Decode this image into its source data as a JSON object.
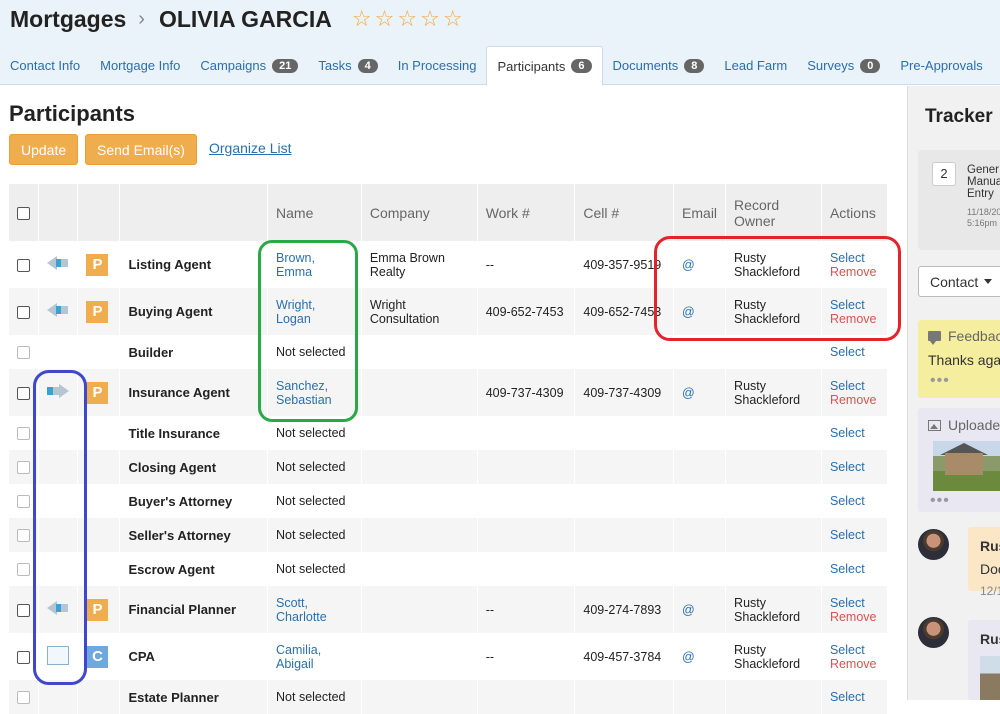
{
  "header": {
    "app": "Mortgages",
    "separator": "›",
    "contact_name": "OLIVIA GARCIA",
    "rating_stars": 0,
    "star_glyph": "☆"
  },
  "tabs": [
    {
      "label": "Contact Info",
      "badge": ""
    },
    {
      "label": "Mortgage Info",
      "badge": ""
    },
    {
      "label": "Campaigns",
      "badge": "21"
    },
    {
      "label": "Tasks",
      "badge": "4"
    },
    {
      "label": "In Processing",
      "badge": ""
    },
    {
      "label": "Participants",
      "badge": "6",
      "active": true
    },
    {
      "label": "Documents",
      "badge": "8"
    },
    {
      "label": "Lead Farm",
      "badge": ""
    },
    {
      "label": "Surveys",
      "badge": "0"
    },
    {
      "label": "Pre-Approvals",
      "badge": ""
    },
    {
      "label": "R",
      "badge": ""
    }
  ],
  "main": {
    "title": "Participants",
    "update_label": "Update",
    "send_label": "Send Email(s)",
    "organize_label": "Organize List"
  },
  "table": {
    "headers": {
      "name": "Name",
      "company": "Company",
      "work": "Work #",
      "cell": "Cell #",
      "email": "Email",
      "owner": "Record Owner",
      "actions": "Actions"
    },
    "rows": [
      {
        "role": "Listing Agent",
        "arrow": "left",
        "badge": "P",
        "name": "Brown, Emma",
        "company": "Emma Brown Realty",
        "work": "--",
        "cell": "409-357-9519",
        "email": "@",
        "owner": "Rusty Shackleford",
        "select": "Select",
        "remove": "Remove"
      },
      {
        "role": "Buying Agent",
        "arrow": "left",
        "badge": "P",
        "name": "Wright, Logan",
        "company": "Wright Consultation",
        "work": "409-652-7453",
        "cell": "409-652-7453",
        "email": "@",
        "owner": "Rusty Shackleford",
        "select": "Select",
        "remove": "Remove"
      },
      {
        "role": "Builder",
        "arrow": "",
        "badge": "",
        "name": "Not selected",
        "company": "",
        "work": "",
        "cell": "",
        "email": "",
        "owner": "",
        "select": "Select",
        "remove": ""
      },
      {
        "role": "Insurance Agent",
        "arrow": "right",
        "badge": "P",
        "name": "Sanchez, Sebastian",
        "company": "",
        "work": "409-737-4309",
        "cell": "409-737-4309",
        "email": "@",
        "owner": "Rusty Shackleford",
        "select": "Select",
        "remove": "Remove"
      },
      {
        "role": "Title Insurance",
        "arrow": "",
        "badge": "",
        "name": "Not selected",
        "company": "",
        "work": "",
        "cell": "",
        "email": "",
        "owner": "",
        "select": "Select",
        "remove": ""
      },
      {
        "role": "Closing Agent",
        "arrow": "",
        "badge": "",
        "name": "Not selected",
        "company": "",
        "work": "",
        "cell": "",
        "email": "",
        "owner": "",
        "select": "Select",
        "remove": ""
      },
      {
        "role": "Buyer's Attorney",
        "arrow": "",
        "badge": "",
        "name": "Not selected",
        "company": "",
        "work": "",
        "cell": "",
        "email": "",
        "owner": "",
        "select": "Select",
        "remove": ""
      },
      {
        "role": "Seller's Attorney",
        "arrow": "",
        "badge": "",
        "name": "Not selected",
        "company": "",
        "work": "",
        "cell": "",
        "email": "",
        "owner": "",
        "select": "Select",
        "remove": ""
      },
      {
        "role": "Escrow Agent",
        "arrow": "",
        "badge": "",
        "name": "Not selected",
        "company": "",
        "work": "",
        "cell": "",
        "email": "",
        "owner": "",
        "select": "Select",
        "remove": ""
      },
      {
        "role": "Financial Planner",
        "arrow": "left",
        "badge": "P",
        "name": "Scott, Charlotte",
        "company": "",
        "work": "--",
        "cell": "409-274-7893",
        "email": "@",
        "owner": "Rusty Shackleford",
        "select": "Select",
        "remove": "Remove"
      },
      {
        "role": "CPA",
        "arrow": "box",
        "badge": "C",
        "name": "Camilia, Abigail",
        "company": "",
        "work": "--",
        "cell": "409-457-3784",
        "email": "@",
        "owner": "Rusty Shackleford",
        "select": "Select",
        "remove": "Remove"
      },
      {
        "role": "Estate Planner",
        "arrow": "",
        "badge": "",
        "name": "Not selected",
        "company": "",
        "work": "",
        "cell": "",
        "email": "",
        "owner": "",
        "select": "Select",
        "remove": ""
      }
    ]
  },
  "tracker": {
    "title": "Tracker",
    "card_number": "2",
    "card_text": "Gener Manua Entry",
    "card_date": "11/18/20 5:16pm",
    "contact_label": "Contact",
    "feedback_label": "Feedbac",
    "feedback_text": "Thanks aga",
    "upload_label": "Uploade",
    "dots": "•••",
    "msg1_name": "Rus",
    "msg1_text": "Doc",
    "msg1_date": "12/1",
    "msg2_name": "Rus"
  },
  "colors": {
    "accent": "#2a6fad",
    "button": "#f0ad4e",
    "remove": "#d9534f",
    "highlight_green": "#2aa845",
    "highlight_red": "#e3242b",
    "highlight_blue": "#3f48cc"
  }
}
